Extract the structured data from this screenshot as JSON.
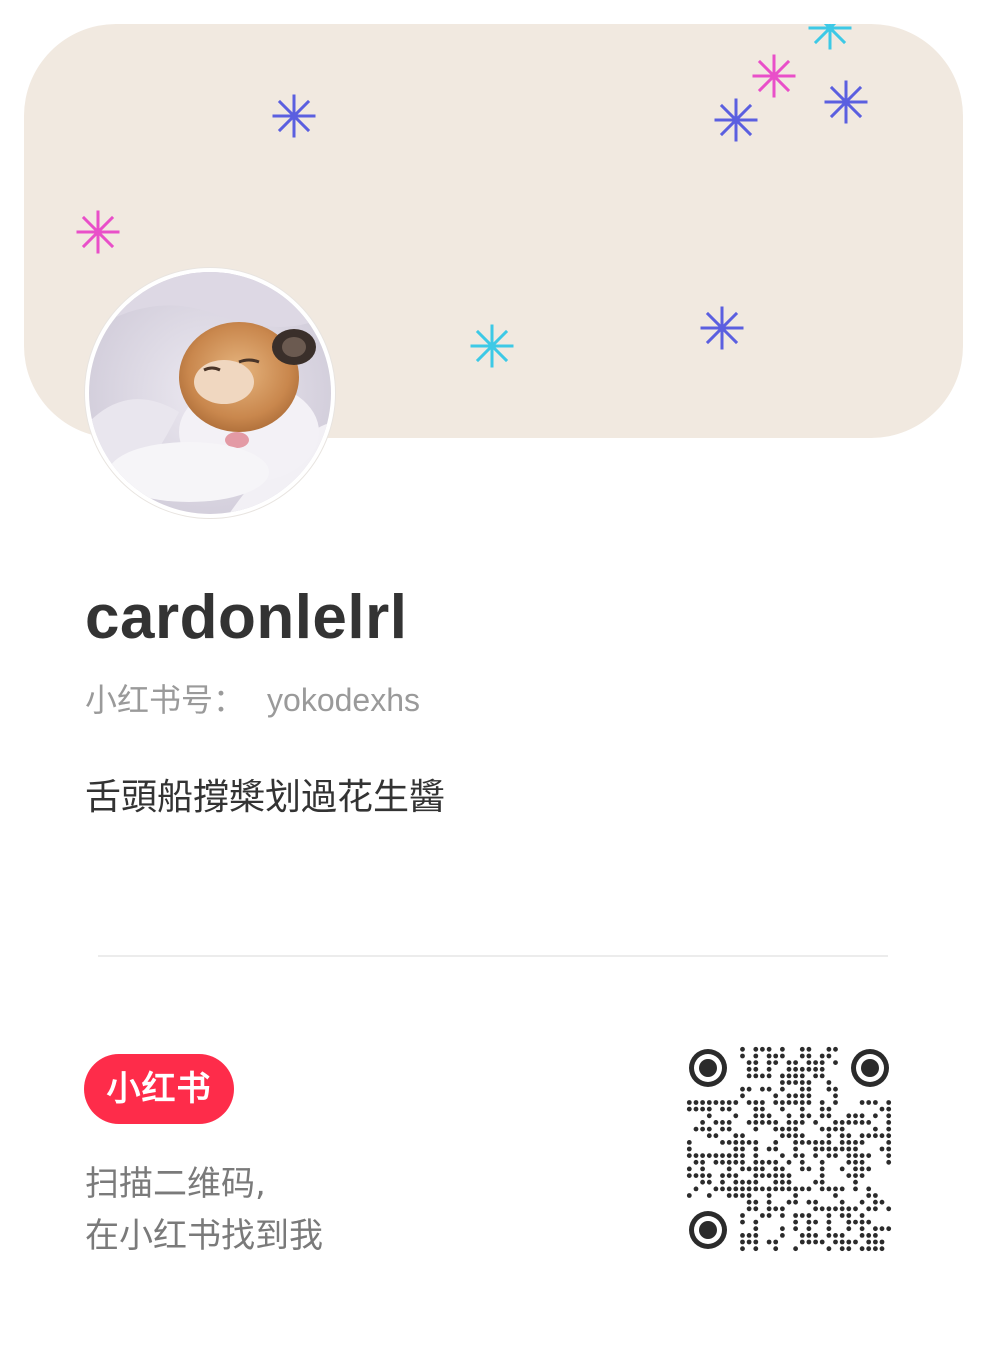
{
  "profile": {
    "username": "cardonlelrl",
    "id_label": "小红书号：",
    "id_value": "yokodexhs",
    "bio": "舌頭船撐槳划過花生醬",
    "avatar_icon": "hamster-photo-avatar"
  },
  "banner": {
    "background": "#f1e9e0",
    "decoration_icon": "sparkle-icon",
    "sparkle_colors": [
      "#5b5fe0",
      "#e94fc9",
      "#3dc9e6"
    ]
  },
  "footer": {
    "logo_text": "小红书",
    "logo_color": "#fe2c4a",
    "scan_line1": "扫描二维码,",
    "scan_line2": "在小红书找到我",
    "qr_icon": "qr-code"
  }
}
